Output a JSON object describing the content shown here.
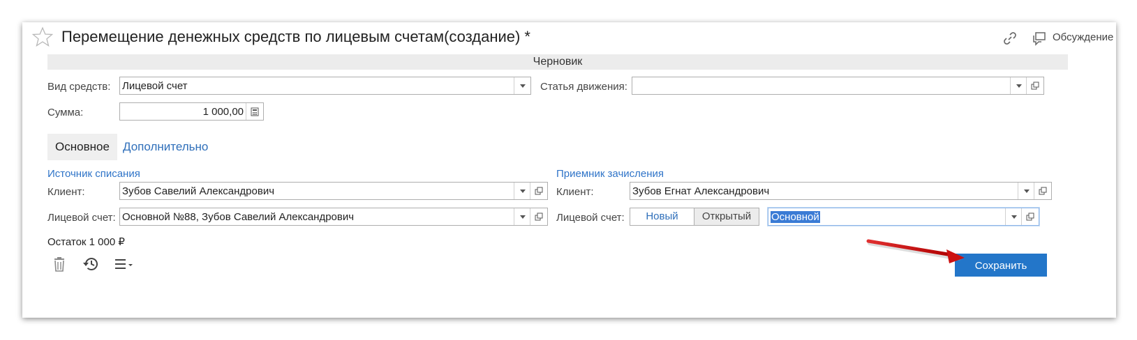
{
  "window": {
    "title": "Перемещение денежных средств по лицевым счетам(создание) *",
    "discussion_label": "Обсуждение"
  },
  "status": "Черновик",
  "form": {
    "fund_type_label": "Вид средств:",
    "fund_type_value": "Лицевой счет",
    "movement_label": "Статья движения:",
    "movement_value": "",
    "amount_label": "Сумма:",
    "amount_value": "1 000,00"
  },
  "tabs": [
    {
      "label": "Основное",
      "active": true
    },
    {
      "label": "Дополнительно",
      "active": false
    }
  ],
  "source": {
    "title": "Источник списания",
    "client_label": "Клиент:",
    "client_value": "Зубов Савелий Александрович",
    "account_label": "Лицевой счет:",
    "account_value": "Основной №88, Зубов Савелий Александрович"
  },
  "receiver": {
    "title": "Приемник зачисления",
    "client_label": "Клиент:",
    "client_value": "Зубов Егнат Александрович",
    "account_label": "Лицевой счет:",
    "mode_new": "Новый",
    "mode_open": "Открытый",
    "account_value": "Основной"
  },
  "balance": "Остаток 1 000 ₽",
  "toolbar": {
    "save_label": "Сохранить"
  },
  "colors": {
    "accent": "#2376c9",
    "link": "#2f74c8",
    "arrow": "#cc1111"
  }
}
